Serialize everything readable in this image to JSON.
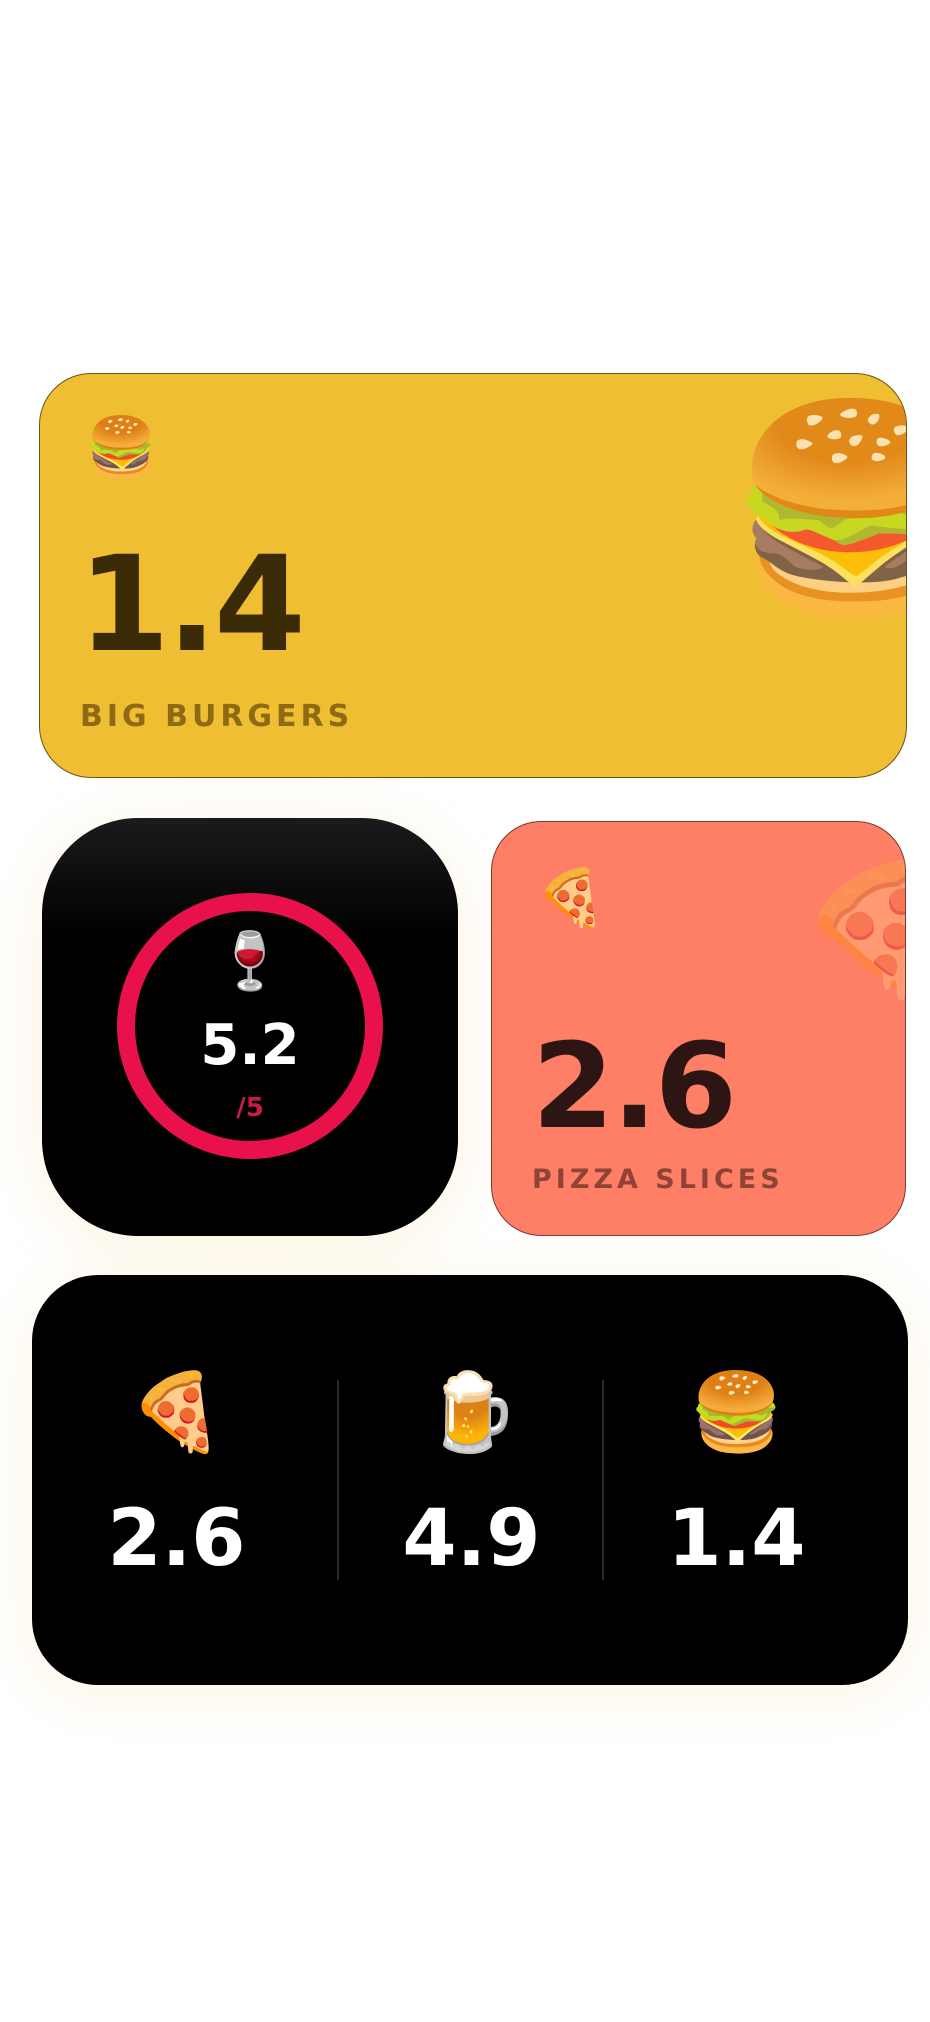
{
  "burger_widget": {
    "icon": "🍔",
    "value": "1.4",
    "label": "BIG BURGERS",
    "accent": "#F0BE33"
  },
  "wine_widget": {
    "icon": "🍷",
    "value": "5.2",
    "goal": "/5",
    "ring_progress": 1.0,
    "ring_color": "#E8114B"
  },
  "pizza_widget": {
    "icon": "🍕",
    "value": "2.6",
    "label": "PIZZA SLICES",
    "accent": "#FF7F66"
  },
  "summary_widget": {
    "items": [
      {
        "icon": "🍕",
        "value": "2.6"
      },
      {
        "icon": "🍺",
        "value": "4.9"
      },
      {
        "icon": "🍔",
        "value": "1.4"
      }
    ]
  }
}
